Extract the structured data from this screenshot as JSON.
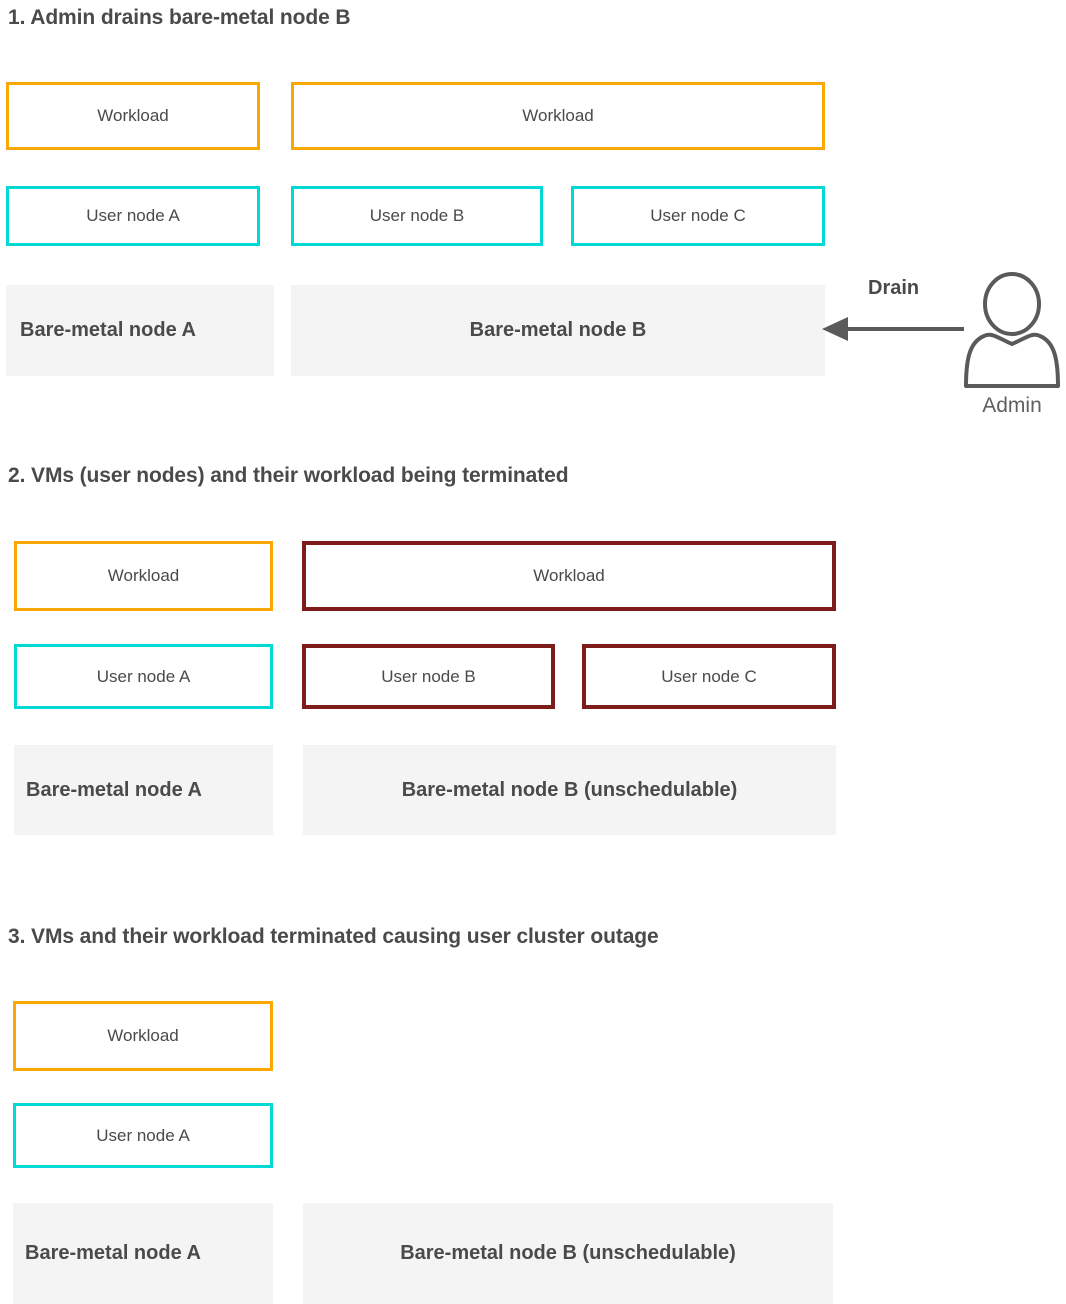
{
  "colors": {
    "workload_border": "#f9a800",
    "usernode_border": "#00d9d5",
    "terminated_border": "#7e1c1c",
    "baremetal_fill": "#f4f4f4",
    "text": "#4a4a4a",
    "arrow": "#5a5a5a"
  },
  "sections": [
    {
      "title": "1. Admin drains bare-metal node B",
      "workloads": [
        {
          "label": "Workload"
        },
        {
          "label": "Workload"
        }
      ],
      "user_nodes": [
        {
          "label": "User node A"
        },
        {
          "label": "User node B"
        },
        {
          "label": "User node C"
        }
      ],
      "bare_metal_nodes": [
        {
          "label": "Bare-metal node A"
        },
        {
          "label": "Bare-metal node B"
        }
      ],
      "annotation": {
        "arrow_label": "Drain",
        "actor_label": "Admin",
        "actor_icon": "person-icon",
        "arrow_icon": "arrow-left-icon"
      }
    },
    {
      "title": "2. VMs (user nodes) and their workload being terminated",
      "workloads": [
        {
          "label": "Workload"
        },
        {
          "label": "Workload"
        }
      ],
      "user_nodes": [
        {
          "label": "User node A"
        },
        {
          "label": "User node B"
        },
        {
          "label": "User node C"
        }
      ],
      "bare_metal_nodes": [
        {
          "label": "Bare-metal node A"
        },
        {
          "label": "Bare-metal node B (unschedulable)"
        }
      ]
    },
    {
      "title": "3. VMs and their workload terminated causing user cluster outage",
      "workloads": [
        {
          "label": "Workload"
        }
      ],
      "user_nodes": [
        {
          "label": "User node A"
        }
      ],
      "bare_metal_nodes": [
        {
          "label": "Bare-metal node A"
        },
        {
          "label": "Bare-metal node B (unschedulable)"
        }
      ]
    }
  ]
}
